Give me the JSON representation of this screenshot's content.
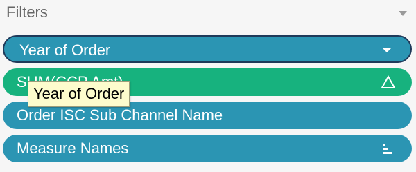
{
  "panel": {
    "title": "Filters",
    "menu_icon": "caret-down-icon"
  },
  "filters": [
    {
      "label": "Year of Order",
      "icon": "caret-down-icon",
      "color": "#2b95b3",
      "selected": true
    },
    {
      "label": "SUM(CCP Amt)",
      "icon": "delta-icon",
      "color": "#17b27e"
    },
    {
      "label": "Order ISC Sub Channel Name",
      "icon": "",
      "color": "#2b95b3"
    },
    {
      "label": "Measure Names",
      "icon": "sort-bars-icon",
      "color": "#2b95b3"
    }
  ],
  "tooltip": {
    "text": "Year of Order"
  }
}
